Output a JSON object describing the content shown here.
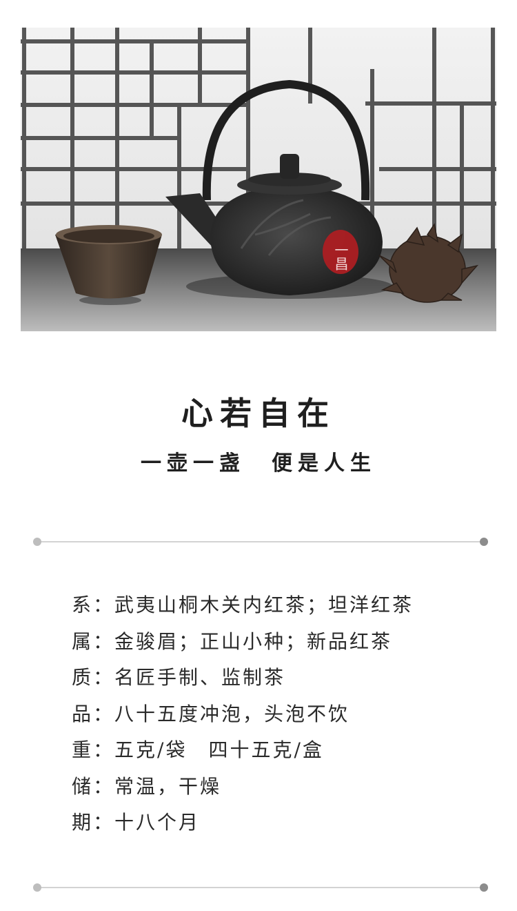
{
  "photo": {
    "alt": "cast iron teapot with cup and pine cone",
    "seal_text": "一昌",
    "colors": {
      "seal": "#b01d22",
      "teapot": "#2e2e2e",
      "window": "#3a3a3a"
    }
  },
  "title": "心若自在",
  "subtitle": "一壶一盏　便是人生",
  "specs": [
    {
      "label": "系：",
      "value": "武夷山桐木关内红茶；坦洋红茶"
    },
    {
      "label": "属：",
      "value": "金骏眉；正山小种；新品红茶"
    },
    {
      "label": "质：",
      "value": "名匠手制、监制茶"
    },
    {
      "label": "品：",
      "value": "八十五度冲泡，头泡不饮"
    },
    {
      "label": "重：",
      "value": "五克/袋　四十五克/盒"
    },
    {
      "label": "储：",
      "value": "常温，干燥"
    },
    {
      "label": "期：",
      "value": "十八个月"
    }
  ]
}
